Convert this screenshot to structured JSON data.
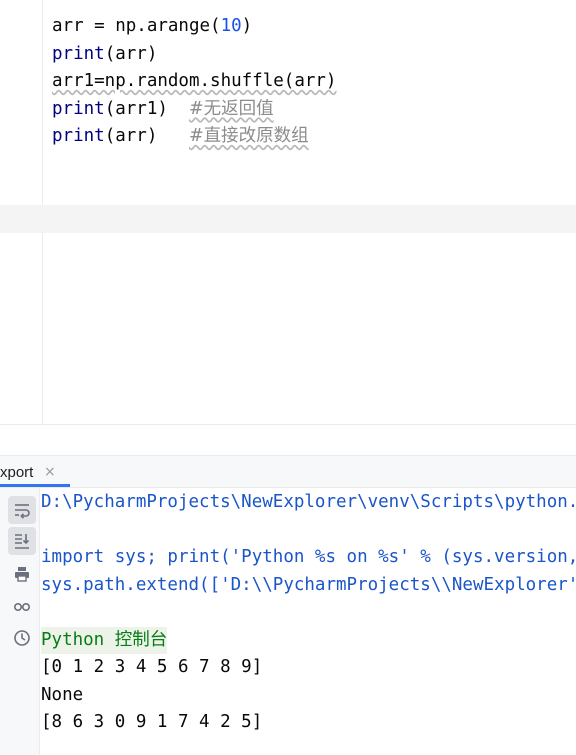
{
  "editor": {
    "lines": [
      {
        "tokens": [
          {
            "t": "arr = np.arange(",
            "k": "plain"
          },
          {
            "t": "10",
            "k": "num"
          },
          {
            "t": ")",
            "k": "plain"
          }
        ]
      },
      {
        "tokens": [
          {
            "t": "print",
            "k": "builtin"
          },
          {
            "t": "(arr)",
            "k": "plain"
          }
        ]
      },
      {
        "tokens": [
          {
            "t": "arr1=np.random.shuffle(arr)",
            "k": "typo"
          }
        ]
      },
      {
        "tokens": [
          {
            "t": "print",
            "k": "builtin"
          },
          {
            "t": "(arr1)  ",
            "k": "plain"
          },
          {
            "t": "#无返回值",
            "k": "comment"
          }
        ]
      },
      {
        "tokens": [
          {
            "t": "print",
            "k": "builtin"
          },
          {
            "t": "(arr)   ",
            "k": "plain"
          },
          {
            "t": "#直接改原数组",
            "k": "comment"
          }
        ]
      }
    ]
  },
  "run_panel": {
    "tab_label": "xport",
    "close_glyph": "×",
    "toolbar": [
      {
        "name": "soft-wrap-icon",
        "active": true
      },
      {
        "name": "scroll-to-end-icon",
        "active": true
      },
      {
        "name": "print-icon",
        "active": false
      },
      {
        "name": "glasses-icon",
        "active": false
      },
      {
        "name": "clock-icon",
        "active": false
      }
    ]
  },
  "console": {
    "lines": [
      {
        "text": "D:\\PycharmProjects\\NewExplorer\\venv\\Scripts\\python.exe",
        "kind": "cmd"
      },
      {
        "text": "",
        "kind": "blank"
      },
      {
        "text": "import sys; print('Python %s on %s' % (sys.version, sys.platform))",
        "kind": "cmd"
      },
      {
        "text": "sys.path.extend(['D:\\\\PycharmProjects\\\\NewExplorer'])",
        "kind": "cmd"
      },
      {
        "text": "",
        "kind": "blank"
      },
      {
        "text": "Python 控制台",
        "kind": "banner"
      },
      {
        "text": "[0 1 2 3 4 5 6 7 8 9]",
        "kind": "output"
      },
      {
        "text": "None",
        "kind": "output"
      },
      {
        "text": "[8 6 3 0 9 1 7 4 2 5]",
        "kind": "output"
      }
    ]
  },
  "colors": {
    "accent": "#3574f0",
    "keyword_blue": "#000080",
    "number_blue": "#1750eb",
    "comment_gray": "#8c8c8c",
    "console_command": "#1a55c9",
    "console_banner": "#067d17"
  }
}
